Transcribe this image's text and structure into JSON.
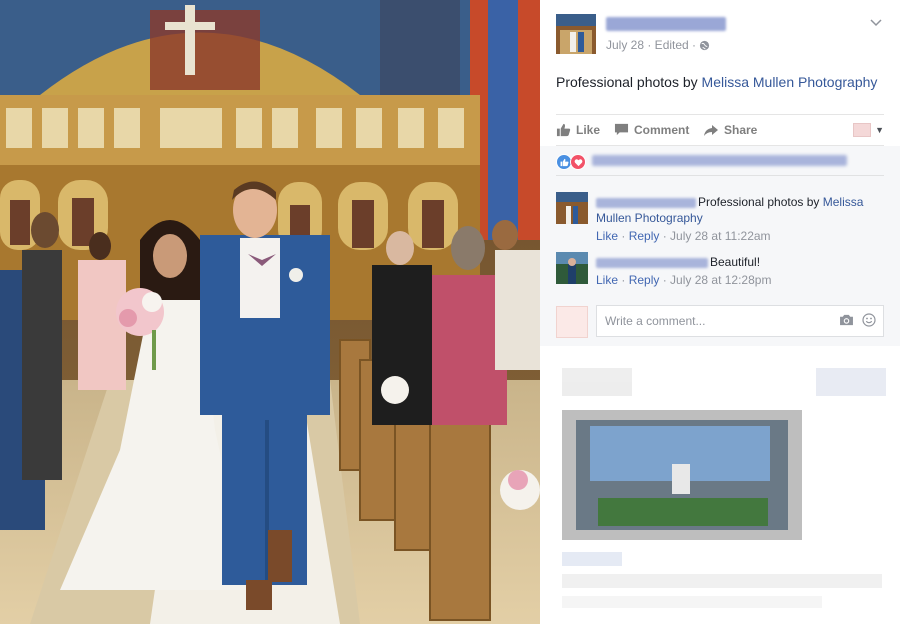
{
  "post": {
    "meta_date": "July 28 · Edited · ",
    "text_prefix": "Professional photos by ",
    "text_link": "Melissa Mullen Photography"
  },
  "actions": {
    "like": "Like",
    "comment": "Comment",
    "share": "Share"
  },
  "comments": [
    {
      "text_prefix": "Professional photos by ",
      "text_link": "Melissa Mullen Photography",
      "like_label": "Like",
      "reply_label": "Reply",
      "time": "July 28 at 11:22am"
    },
    {
      "text_prefix": "Beautiful!",
      "text_link": "",
      "like_label": "Like",
      "reply_label": "Reply",
      "time": "July 28 at 12:28pm"
    }
  ],
  "composer": {
    "placeholder": "Write a comment..."
  },
  "colors": {
    "link": "#365899",
    "like_reaction": "#4a90e2",
    "love_reaction": "#f25268",
    "muted": "#90949c"
  },
  "icons": [
    "thumbs-up-icon",
    "speech-bubble-icon",
    "share-arrow-icon",
    "chevron-down-icon",
    "camera-icon",
    "emoji-icon",
    "globe-icon"
  ]
}
